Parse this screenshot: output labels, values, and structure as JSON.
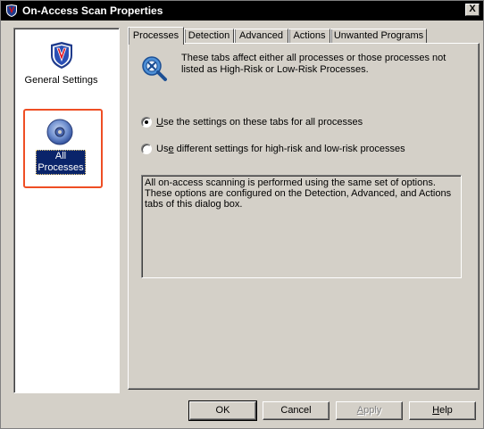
{
  "window": {
    "title": "On-Access Scan Properties",
    "close_glyph": "X"
  },
  "nav": {
    "items": [
      {
        "label": "General Settings",
        "icon": "shield-v-icon",
        "selected": false
      },
      {
        "label": "All Processes",
        "icon": "disc-icon",
        "selected": true
      }
    ]
  },
  "tabs": [
    {
      "label": "Processes",
      "active": true
    },
    {
      "label": "Detection",
      "active": false
    },
    {
      "label": "Advanced",
      "active": false
    },
    {
      "label": "Actions",
      "active": false
    },
    {
      "label": "Unwanted Programs",
      "active": false
    }
  ],
  "panel": {
    "info_text": "These tabs affect either all processes or those processes not listed as High-Risk or Low-Risk Processes.",
    "option_all": {
      "label_underlined": "U",
      "label_rest": "se the settings on these tabs for all processes",
      "checked": true
    },
    "option_split": {
      "label_prefix": "Us",
      "label_underlined": "e",
      "label_rest": " different settings for high-risk and low-risk processes",
      "checked": false
    },
    "description": "All on-access scanning is performed using the same set of options. These options are configured on the Detection, Advanced, and Actions tabs of this dialog box."
  },
  "buttons": {
    "ok": "OK",
    "cancel": "Cancel",
    "apply": {
      "underlined": "A",
      "rest": "pply",
      "enabled": false
    },
    "help": {
      "underlined": "H",
      "rest": "elp"
    }
  },
  "colors": {
    "highlight_frame": "#ef4e24",
    "selection_bg": "#0a246a",
    "dialog_bg": "#d4d0c8"
  }
}
